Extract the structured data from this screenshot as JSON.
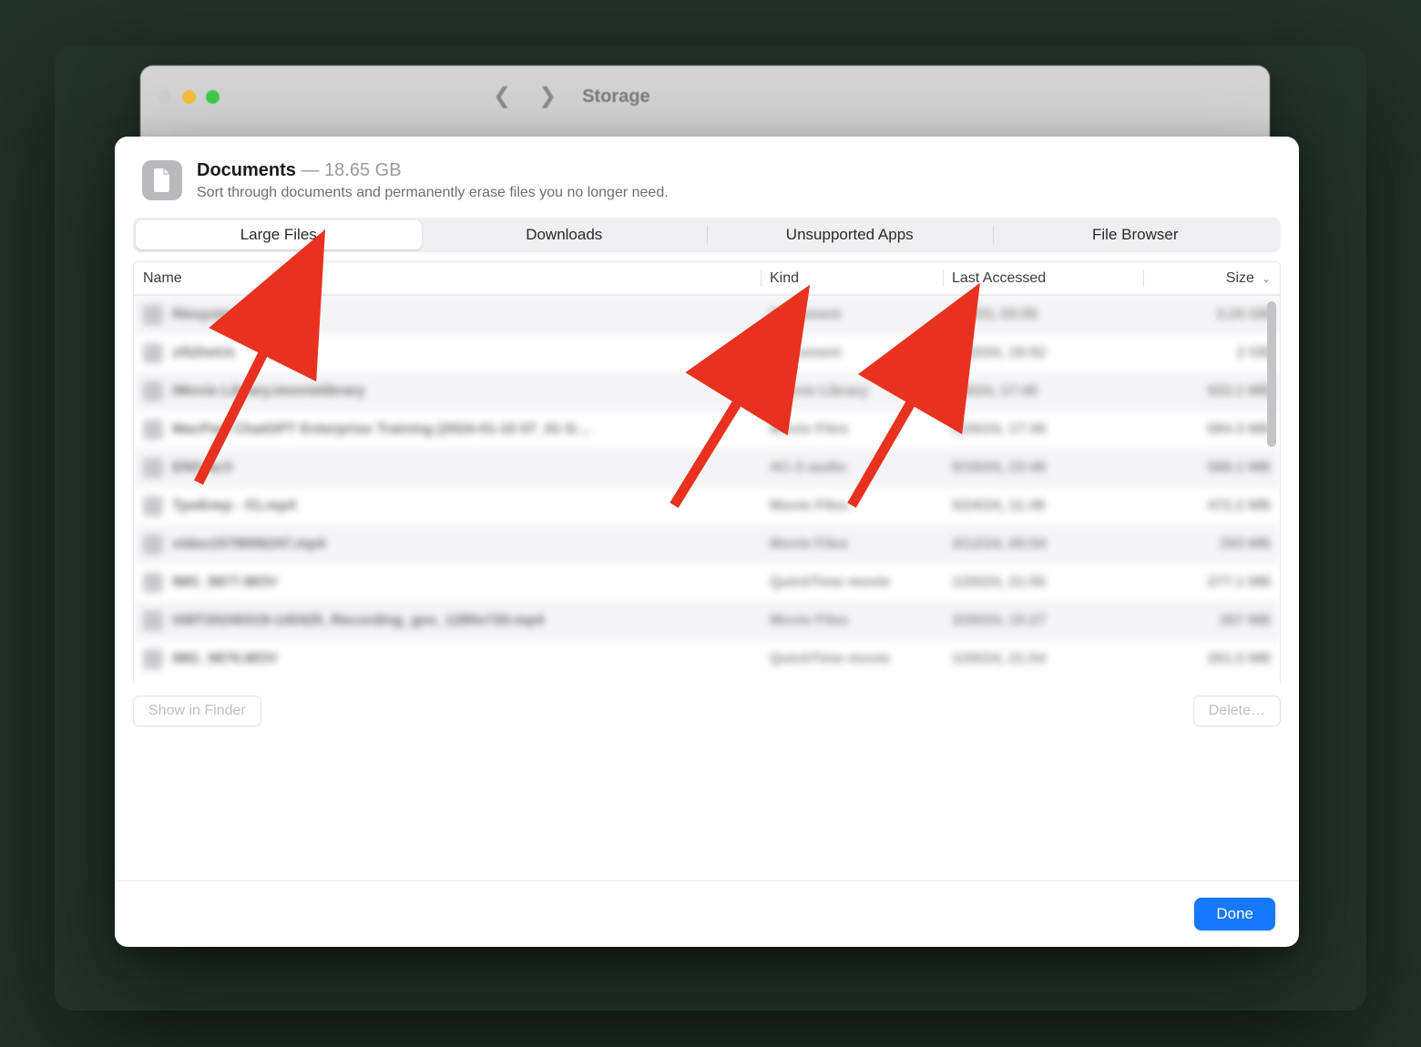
{
  "parent_window": {
    "title": "Storage"
  },
  "header": {
    "title": "Documents",
    "separator": " — ",
    "size": "18.65 GB",
    "subtitle": "Sort through documents and permanently erase files you no longer need."
  },
  "tabs": [
    {
      "label": "Large Files",
      "active": true
    },
    {
      "label": "Downloads"
    },
    {
      "label": "Unsupported Apps"
    },
    {
      "label": "File Browser"
    }
  ],
  "columns": {
    "name": "Name",
    "kind": "Kind",
    "accessed": "Last Accessed",
    "size": "Size"
  },
  "files": [
    {
      "name": "filesystem.squashfs",
      "kind": "Document",
      "accessed": "8/8/23, 03:05",
      "size": "3.24 GB"
    },
    {
      "name": "zl52heUx",
      "kind": "Document",
      "accessed": "7/22/24, 19:52",
      "size": "2 GB"
    },
    {
      "name": "iMovie Library.imovielibrary",
      "kind": "iMovie Library",
      "accessed": "7/6/24, 17:40",
      "size": "933.1 MB"
    },
    {
      "name": "MacPaw ChatGPT Enterprise Training (2024-01-10 07_01 G…",
      "kind": "Movie Files",
      "accessed": "1/26/24, 17:36",
      "size": "684.3 MB"
    },
    {
      "name": "ENG.ac3",
      "kind": "AC-3 audio",
      "accessed": "5/16/24, 23:49",
      "size": "568.1 MB"
    },
    {
      "name": "Трейлер - 01.mp4",
      "kind": "Movie Files",
      "accessed": "5/24/24, 11:48",
      "size": "472.2 MB"
    },
    {
      "name": "video1579006247.mp4",
      "kind": "Movie Files",
      "accessed": "3/12/24, 09:54",
      "size": "293 MB"
    },
    {
      "name": "IMG_9877.MOV",
      "kind": "QuickTime movie",
      "accessed": "1/20/24, 21:55",
      "size": "277.1 MB"
    },
    {
      "name": "GMT20240319-140425_Recording_gvo_1280x720.mp4",
      "kind": "Movie Files",
      "accessed": "3/20/24, 10:27",
      "size": "267 MB"
    },
    {
      "name": "IMG_9876.MOV",
      "kind": "QuickTime movie",
      "accessed": "1/20/24, 21:54",
      "size": "261.5 MB"
    }
  ],
  "buttons": {
    "show_in_finder": "Show in Finder",
    "delete": "Delete…",
    "done": "Done"
  }
}
